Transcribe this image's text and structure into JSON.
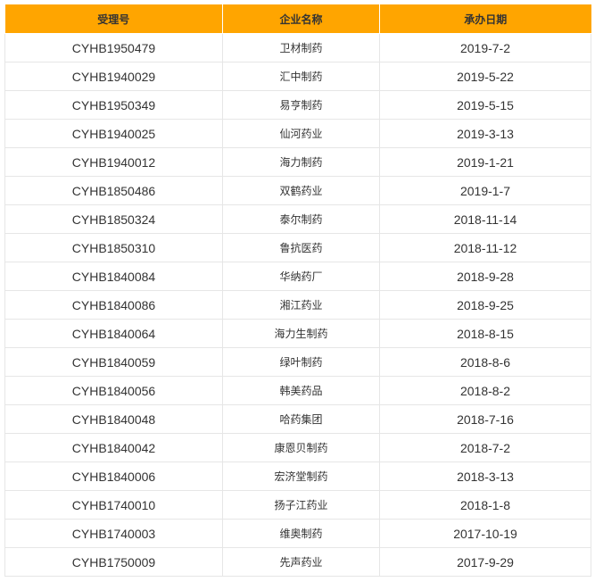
{
  "table": {
    "headers": [
      "受理号",
      "企业名称",
      "承办日期"
    ],
    "rows": [
      {
        "code": "CYHB1950479",
        "company": "卫材制药",
        "date": "2019-7-2"
      },
      {
        "code": "CYHB1940029",
        "company": "汇中制药",
        "date": "2019-5-22"
      },
      {
        "code": "CYHB1950349",
        "company": "易亨制药",
        "date": "2019-5-15"
      },
      {
        "code": "CYHB1940025",
        "company": "仙河药业",
        "date": "2019-3-13"
      },
      {
        "code": "CYHB1940012",
        "company": "海力制药",
        "date": "2019-1-21"
      },
      {
        "code": "CYHB1850486",
        "company": "双鹤药业",
        "date": "2019-1-7"
      },
      {
        "code": "CYHB1850324",
        "company": "泰尔制药",
        "date": "2018-11-14"
      },
      {
        "code": "CYHB1850310",
        "company": "鲁抗医药",
        "date": "2018-11-12"
      },
      {
        "code": "CYHB1840084",
        "company": "华纳药厂",
        "date": "2018-9-28"
      },
      {
        "code": "CYHB1840086",
        "company": "湘江药业",
        "date": "2018-9-25"
      },
      {
        "code": "CYHB1840064",
        "company": "海力生制药",
        "date": "2018-8-15"
      },
      {
        "code": "CYHB1840059",
        "company": "绿叶制药",
        "date": "2018-8-6"
      },
      {
        "code": "CYHB1840056",
        "company": "韩美药品",
        "date": "2018-8-2"
      },
      {
        "code": "CYHB1840048",
        "company": "哈药集团",
        "date": "2018-7-16"
      },
      {
        "code": "CYHB1840042",
        "company": "康恩贝制药",
        "date": "2018-7-2"
      },
      {
        "code": "CYHB1840006",
        "company": "宏济堂制药",
        "date": "2018-3-13"
      },
      {
        "code": "CYHB1740010",
        "company": "扬子江药业",
        "date": "2018-1-8"
      },
      {
        "code": "CYHB1740003",
        "company": "维奥制药",
        "date": "2017-10-19"
      },
      {
        "code": "CYHB1750009",
        "company": "先声药业",
        "date": "2017-9-29"
      }
    ]
  },
  "colors": {
    "header_bg": "#ffa500",
    "border": "#e6e6e6",
    "text": "#333333"
  }
}
